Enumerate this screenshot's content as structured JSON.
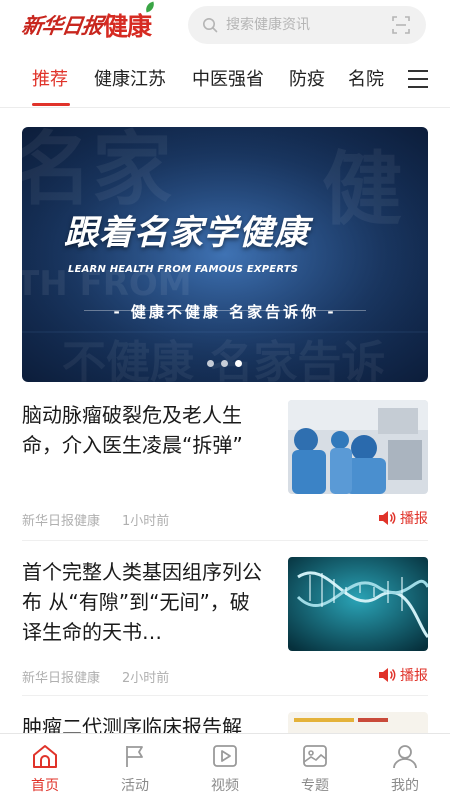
{
  "header": {
    "logo_script": "新华日报",
    "logo_health": "健康",
    "search_placeholder": "搜索健康资讯"
  },
  "tabs": [
    {
      "label": "推荐",
      "active": true
    },
    {
      "label": "健康江苏",
      "active": false
    },
    {
      "label": "中医强省",
      "active": false
    },
    {
      "label": "防疫",
      "active": false
    },
    {
      "label": "名院",
      "active": false
    }
  ],
  "banner": {
    "title": "跟着名家学健康",
    "subtitle": "LEARN HEALTH FROM FAMOUS EXPERTS",
    "slogan": "- 健康不健康  名家告诉你 -",
    "active_dot": 2,
    "dot_count": 3
  },
  "news": [
    {
      "title": "脑动脉瘤破裂危及老人生命，介入医生凌晨“拆弹”",
      "source": "新华日报健康",
      "time": "1小时前",
      "play_label": "播报",
      "thumb_icon": "surgery-photo"
    },
    {
      "title": "首个完整人类基因组序列公布 从“有隙”到“无间”，破译生命的天书…",
      "source": "新华日报健康",
      "time": "2小时前",
      "play_label": "播报",
      "thumb_icon": "dna-photo"
    },
    {
      "title": "肿瘤二代测序临床报告解",
      "thumb_icon": "report-photo"
    }
  ],
  "bottom_nav": [
    {
      "label": "首页",
      "icon": "home-icon",
      "active": true
    },
    {
      "label": "活动",
      "icon": "flag-icon",
      "active": false
    },
    {
      "label": "视频",
      "icon": "video-icon",
      "active": false
    },
    {
      "label": "专题",
      "icon": "topic-icon",
      "active": false
    },
    {
      "label": "我的",
      "icon": "user-icon",
      "active": false
    }
  ],
  "colors": {
    "accent": "#e0332a",
    "logo_red": "#c8261e",
    "search_bg": "#f1f1f1",
    "muted_text": "#b0b0b0"
  }
}
